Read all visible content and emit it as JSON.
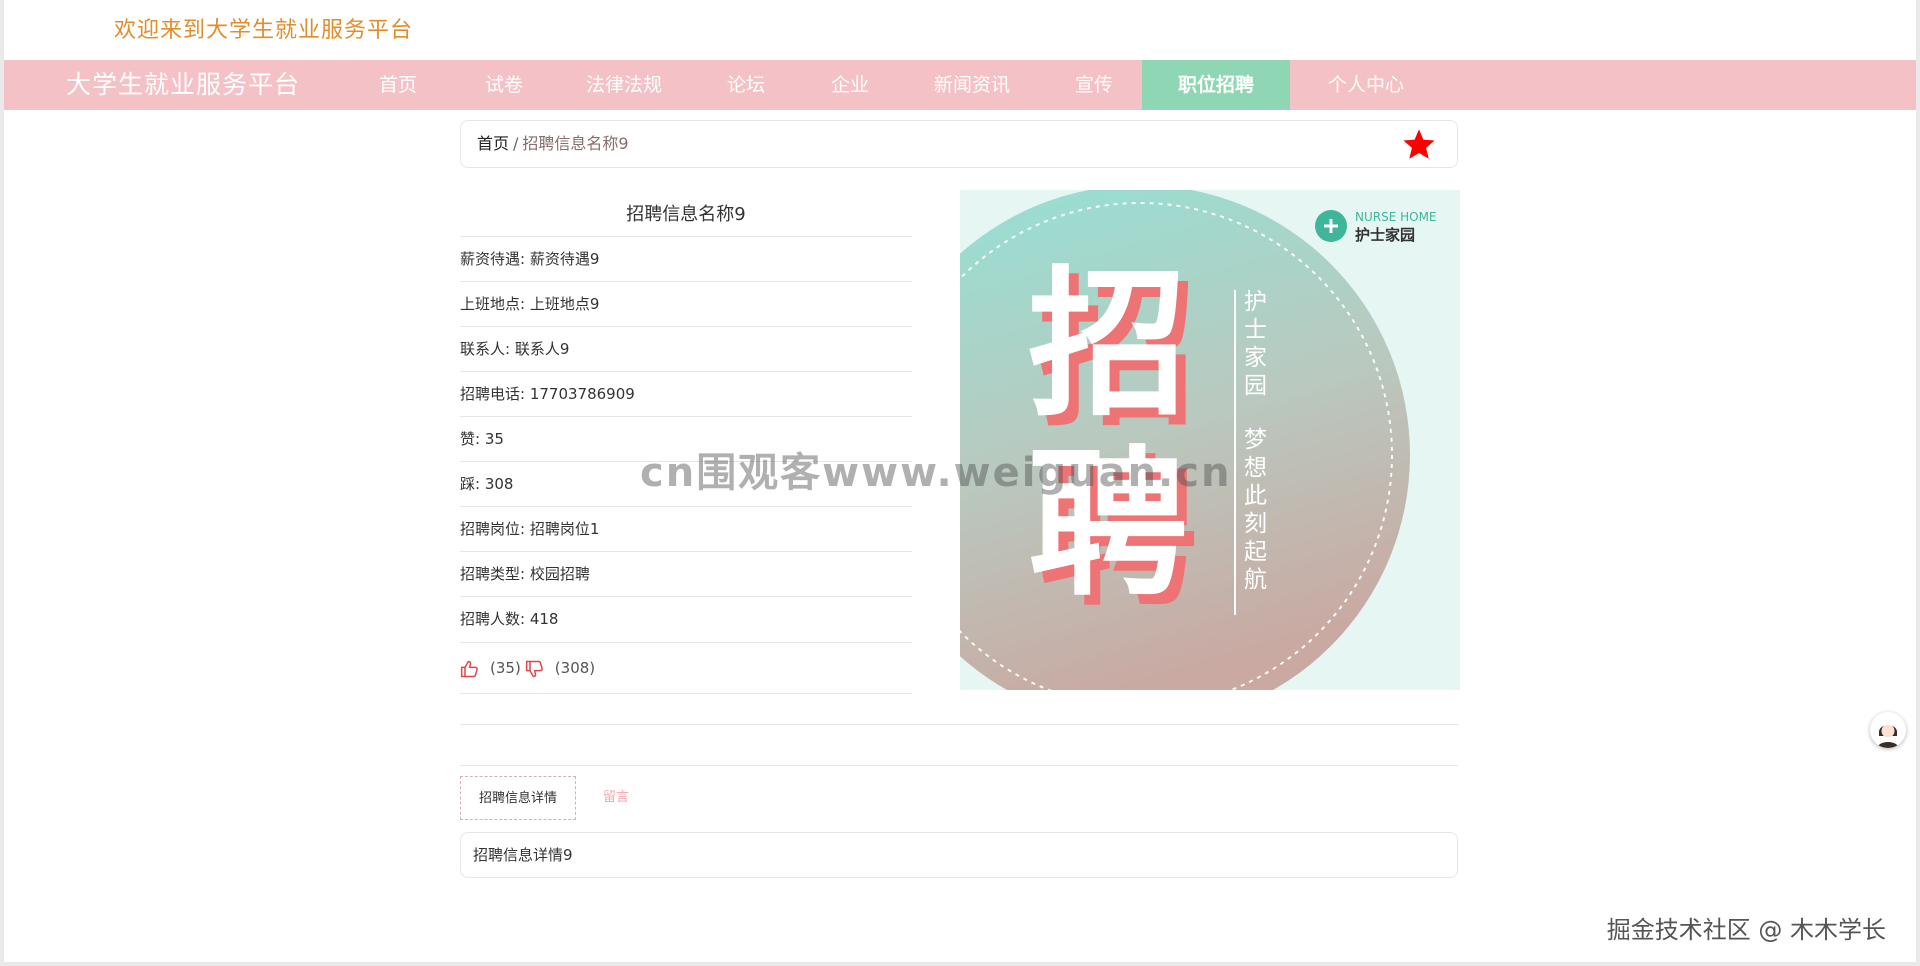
{
  "header": {
    "welcome": "欢迎来到大学生就业服务平台",
    "site_title": "大学生就业服务平台"
  },
  "nav": {
    "items": [
      {
        "label": "首页"
      },
      {
        "label": "试卷"
      },
      {
        "label": "法律法规"
      },
      {
        "label": "论坛"
      },
      {
        "label": "企业"
      },
      {
        "label": "新闻资讯"
      },
      {
        "label": "宣传"
      },
      {
        "label": "职位招聘",
        "active": true
      },
      {
        "label": "个人中心"
      }
    ]
  },
  "breadcrumb": {
    "home": "首页",
    "separator": "/",
    "current": "招聘信息名称9"
  },
  "job": {
    "title": "招聘信息名称9",
    "fields": [
      {
        "label": "薪资待遇: 薪资待遇9"
      },
      {
        "label": "上班地点: 上班地点9"
      },
      {
        "label": "联系人: 联系人9"
      },
      {
        "label": "招聘电话: 17703786909"
      },
      {
        "label": "赞: 35"
      },
      {
        "label": "踩: 308"
      },
      {
        "label": "招聘岗位: 招聘岗位1"
      },
      {
        "label": "招聘类型: 校园招聘"
      },
      {
        "label": "招聘人数: 418"
      }
    ],
    "like_count": "(35)",
    "dislike_count": "(308)"
  },
  "poster": {
    "big_text_1": "招",
    "big_text_2": "聘",
    "side_text_1": "护士家园",
    "side_text_2": "梦想此刻起航",
    "brand_en": "NURSE HOME",
    "brand_cn": "护士家园"
  },
  "tabs": [
    {
      "label": "招聘信息详情",
      "active": true
    },
    {
      "label": "留言"
    }
  ],
  "detail": {
    "content": "招聘信息详情9"
  },
  "overlay": {
    "watermark": "cn围观客www.weiguan.cn",
    "credit": "掘金技术社区 @ 木木学长"
  },
  "colors": {
    "nav_bg": "#f4c2c6",
    "nav_active": "#8fd6b4",
    "welcome_text": "#e08d2c",
    "star": "#ff0000",
    "vote_icon": "#e0454a"
  }
}
